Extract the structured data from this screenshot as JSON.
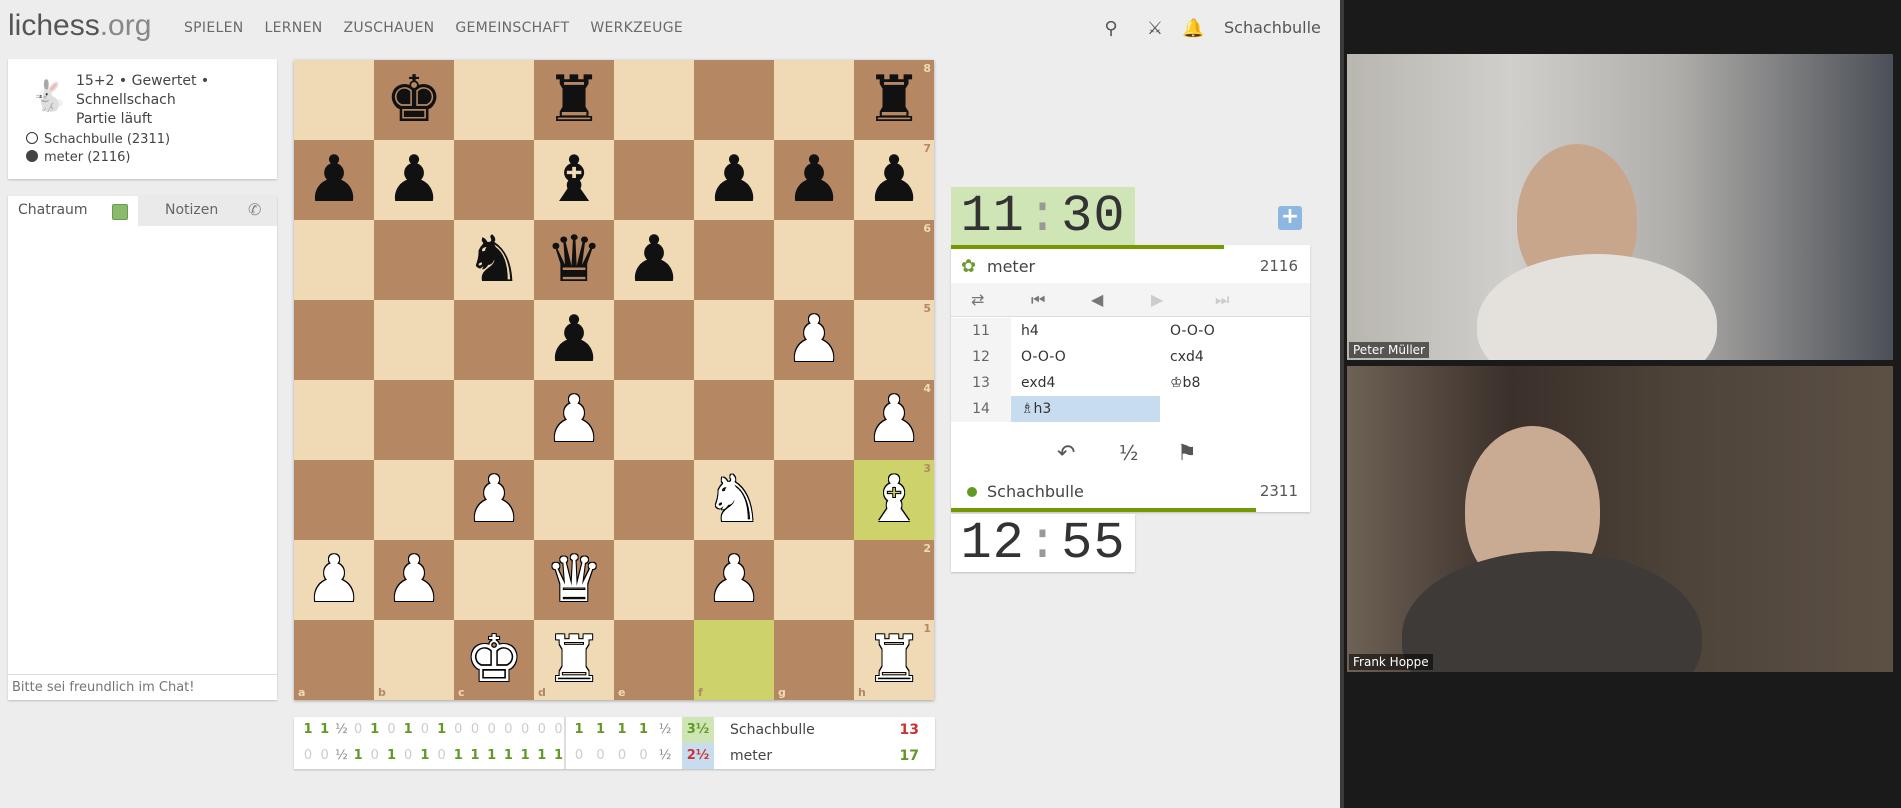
{
  "header": {
    "logo_main": "lichess",
    "logo_dim": ".org",
    "nav": [
      "SPIELEN",
      "LERNEN",
      "ZUSCHAUEN",
      "GEMEINSCHAFT",
      "WERKZEUGE"
    ],
    "username": "Schachbulle"
  },
  "game_info": {
    "line1": "15+2 • Gewertet •",
    "line2": "Schnellschach",
    "line3": "Partie läuft",
    "white_player": "Schachbulle (2311)",
    "black_player": "meter (2116)"
  },
  "chat": {
    "tab_chat": "Chatraum",
    "tab_notes": "Notizen",
    "placeholder": "Bitte sei freundlich im Chat!"
  },
  "board": {
    "ranks": [
      [
        "",
        "bk",
        "",
        "br",
        "",
        "",
        "",
        "br"
      ],
      [
        "bp",
        "bp",
        "",
        "bb",
        "",
        "bp",
        "bp",
        "bp"
      ],
      [
        "",
        "",
        "bn",
        "bq",
        "bp",
        "",
        "",
        ""
      ],
      [
        "",
        "",
        "",
        "bp",
        "",
        "",
        "wp",
        ""
      ],
      [
        "",
        "",
        "",
        "wp",
        "",
        "",
        "",
        "wp"
      ],
      [
        "",
        "",
        "wp",
        "",
        "",
        "wn",
        "",
        "wb"
      ],
      [
        "wp",
        "wp",
        "",
        "wq",
        "",
        "wp",
        "",
        ""
      ],
      [
        "",
        "",
        "wk",
        "wr",
        "",
        "",
        "",
        "wr"
      ]
    ],
    "highlight": [
      "h3",
      "f1"
    ],
    "files": [
      "a",
      "b",
      "c",
      "d",
      "e",
      "f",
      "g",
      "h"
    ],
    "rank_labels": [
      "8",
      "7",
      "6",
      "5",
      "4",
      "3",
      "2",
      "1"
    ]
  },
  "clock_top": {
    "min": "11",
    "sec": "30"
  },
  "clock_bottom": {
    "min": "12",
    "sec": "55"
  },
  "top_player": {
    "name": "meter",
    "rating": "2116",
    "time_fraction": 0.76
  },
  "bottom_player": {
    "name": "Schachbulle",
    "rating": "2311",
    "time_fraction": 0.85
  },
  "moves": [
    {
      "num": "11",
      "white": "h4",
      "black": "O-O-O"
    },
    {
      "num": "12",
      "white": "O-O-O",
      "black": "cxd4"
    },
    {
      "num": "13",
      "white": "exd4",
      "black": "♔b8"
    },
    {
      "num": "14",
      "white": "♗h3",
      "black": ""
    }
  ],
  "crosstable": {
    "rows": [
      {
        "results": [
          "1",
          "1",
          "½",
          "0",
          "1",
          "0",
          "1",
          "0",
          "1",
          "0",
          "0",
          "0",
          "0",
          "0",
          "0",
          "0",
          "1",
          "1",
          "1",
          "1",
          "½"
        ],
        "score": "3½",
        "name": "Schachbulle",
        "total": "13"
      },
      {
        "results": [
          "0",
          "0",
          "½",
          "1",
          "0",
          "1",
          "0",
          "1",
          "0",
          "1",
          "1",
          "1",
          "1",
          "1",
          "1",
          "1",
          "0",
          "0",
          "0",
          "0",
          "½"
        ],
        "score": "2½",
        "name": "meter",
        "total": "17"
      }
    ]
  },
  "videos": [
    {
      "name": "Peter Müller"
    },
    {
      "name": "Frank Hoppe"
    }
  ],
  "colors": {
    "clock_active": "#cfe5b5",
    "win_green": "#629924",
    "highlight": "#cdd26a",
    "light_square": "#f0d9b5",
    "dark_square": "#b58863"
  }
}
